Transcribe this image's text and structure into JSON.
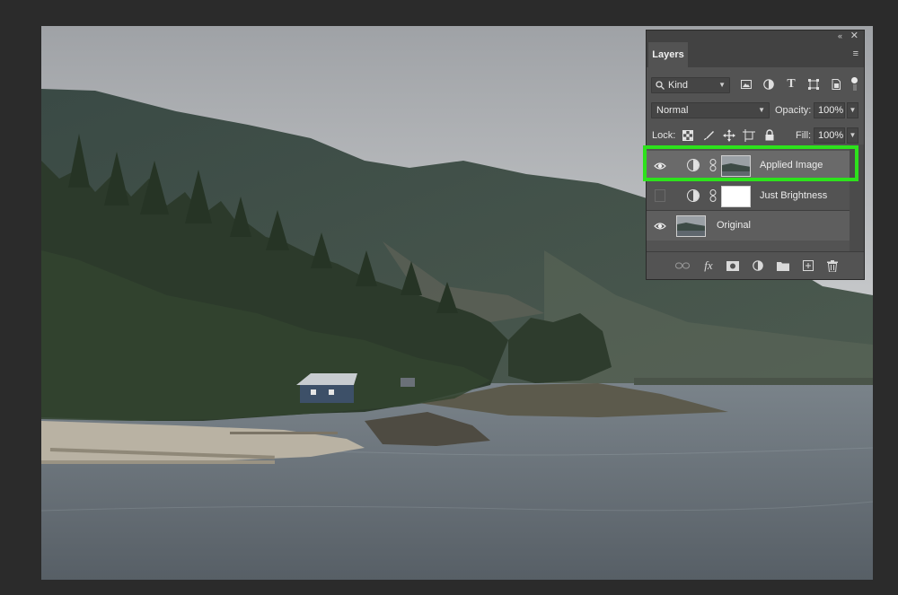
{
  "panel": {
    "collapse_icon": "double-chevron-icon",
    "collapse_label": "«",
    "close_label": "✕",
    "tab_label": "Layers",
    "menu_label": "≡"
  },
  "filter": {
    "kind_label": "Kind",
    "icons": [
      "image-filter-icon",
      "adjustment-filter-icon",
      "type-filter-icon",
      "shape-filter-icon",
      "smart-object-filter-icon"
    ]
  },
  "blend": {
    "mode_value": "Normal",
    "opacity_label": "Opacity:",
    "opacity_value": "100%"
  },
  "lock": {
    "label": "Lock:",
    "icons": [
      "lock-transparent-pixels-icon",
      "lock-image-pixels-icon",
      "lock-position-icon",
      "lock-artboard-icon",
      "lock-all-icon"
    ],
    "fill_label": "Fill:",
    "fill_value": "100%"
  },
  "layers": [
    {
      "name": "Applied Image",
      "visible": true,
      "selected": true,
      "type": "adjustment"
    },
    {
      "name": "Just Brightness",
      "visible": false,
      "selected": false,
      "type": "adjustment"
    },
    {
      "name": "Original",
      "visible": true,
      "selected": false,
      "type": "pixel"
    }
  ],
  "bottom_icons": [
    "link-layers-icon",
    "fx-icon",
    "layer-mask-icon",
    "new-adjustment-icon",
    "new-group-icon",
    "new-layer-icon",
    "delete-layer-icon"
  ],
  "bottom_labels": {
    "fx": "fx"
  },
  "colors": {
    "highlight": "#2de21c",
    "panel_bg": "#535353",
    "selected_row": "#6a6a6a"
  }
}
